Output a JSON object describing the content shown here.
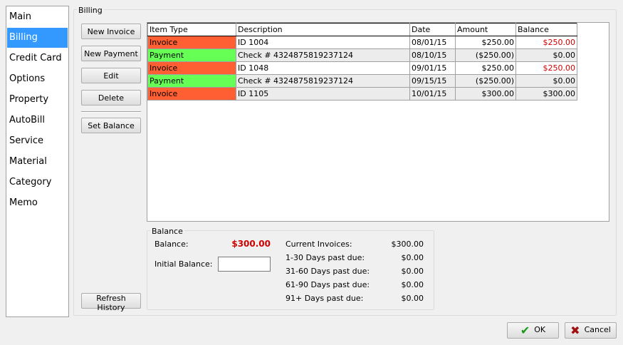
{
  "sidebar": {
    "items": [
      {
        "label": "Main"
      },
      {
        "label": "Billing"
      },
      {
        "label": "Credit Card"
      },
      {
        "label": "Options"
      },
      {
        "label": "Property"
      },
      {
        "label": "AutoBill"
      },
      {
        "label": "Service"
      },
      {
        "label": "Material"
      },
      {
        "label": "Category"
      },
      {
        "label": "Memo"
      }
    ],
    "selected": "Billing"
  },
  "billing": {
    "group_title": "Billing",
    "buttons": {
      "new_invoice": "New Invoice",
      "new_payment": "New Payment",
      "edit": "Edit",
      "delete": "Delete",
      "set_balance": "Set Balance",
      "refresh_history": "Refresh History"
    },
    "table": {
      "columns": [
        "Item Type",
        "Description",
        "Date",
        "Amount",
        "Balance"
      ],
      "rows": [
        {
          "type": "Invoice",
          "description": "ID 1004",
          "date": "08/01/15",
          "amount": "$250.00",
          "balance": "$250.00"
        },
        {
          "type": "Payment",
          "description": "Check # 4324875819237124",
          "date": "08/10/15",
          "amount": "($250.00)",
          "balance": "$0.00"
        },
        {
          "type": "Invoice",
          "description": "ID 1048",
          "date": "09/01/15",
          "amount": "$250.00",
          "balance": "$250.00"
        },
        {
          "type": "Payment",
          "description": "Check # 4324875819237124",
          "date": "09/15/15",
          "amount": "($250.00)",
          "balance": "$0.00"
        },
        {
          "type": "Invoice",
          "description": "ID 1105",
          "date": "10/01/15",
          "amount": "$300.00",
          "balance": "$300.00"
        }
      ]
    }
  },
  "balance": {
    "group_title": "Balance",
    "balance_label": "Balance:",
    "balance_value": "$300.00",
    "initial_balance_label": "Initial Balance:",
    "initial_balance_value": "",
    "aging": [
      {
        "label": "Current Invoices:",
        "value": "$300.00"
      },
      {
        "label": "1-30 Days past due:",
        "value": "$0.00"
      },
      {
        "label": "31-60 Days past due:",
        "value": "$0.00"
      },
      {
        "label": "61-90 Days past due:",
        "value": "$0.00"
      },
      {
        "label": "91+ Days past due:",
        "value": "$0.00"
      }
    ]
  },
  "footer": {
    "ok_label": "OK",
    "cancel_label": "Cancel"
  },
  "colors": {
    "invoice": "#ff5f33",
    "payment": "#66ff55",
    "negative_text": "#d00000",
    "selection": "#3399ff"
  }
}
